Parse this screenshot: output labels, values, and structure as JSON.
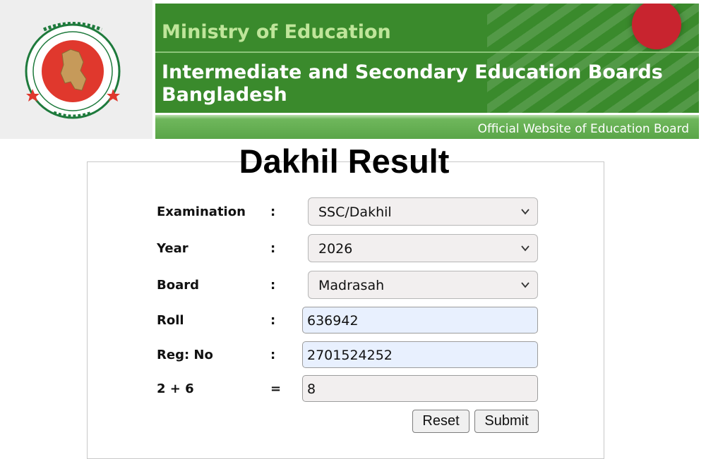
{
  "header": {
    "ministry": "Ministry of Education",
    "boards_line1": "Intermediate and Secondary Education Boards",
    "boards_line2": "Bangladesh",
    "official": "Official Website of Education Board",
    "logo_icon": "government-seal-icon",
    "flag_icon": "bangladesh-flag-icon"
  },
  "page": {
    "title": "Dakhil Result"
  },
  "form": {
    "separator": ":",
    "equals": "=",
    "examination": {
      "label": "Examination",
      "value": "SSC/Dakhil"
    },
    "year": {
      "label": "Year",
      "value": "2026"
    },
    "board": {
      "label": "Board",
      "value": "Madrasah"
    },
    "roll": {
      "label": "Roll",
      "value": "636942"
    },
    "reg_no": {
      "label": "Reg: No",
      "value": "2701524252"
    },
    "captcha": {
      "question": "2 + 6",
      "value": "8"
    },
    "reset_label": "Reset",
    "submit_label": "Submit"
  },
  "colors": {
    "banner_green": "#3a8a2c",
    "ministry_text": "#bfe59a",
    "seal_red": "#e0382d",
    "seal_green": "#1e7a3c",
    "autofill_blue": "#e8f0fe"
  }
}
